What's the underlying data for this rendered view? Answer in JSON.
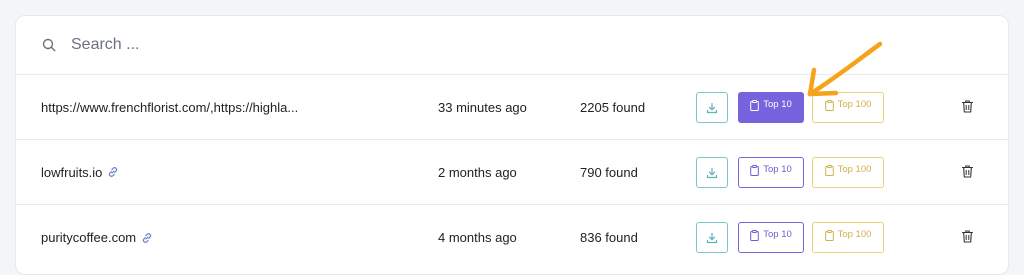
{
  "search": {
    "placeholder": "Search ..."
  },
  "rows": [
    {
      "url": "https://www.frenchflorist.com/,https://highla...",
      "has_link_icon": false,
      "time": "33 minutes ago",
      "count": "2205 found",
      "top10_label": "Top 10",
      "top100_label": "Top 100",
      "top10_active": true
    },
    {
      "url": "lowfruits.io",
      "has_link_icon": true,
      "time": "2 months ago",
      "count": "790 found",
      "top10_label": "Top 10",
      "top100_label": "Top 100",
      "top10_active": false
    },
    {
      "url": "puritycoffee.com",
      "has_link_icon": true,
      "time": "4 months ago",
      "count": "836 found",
      "top10_label": "Top 10",
      "top100_label": "Top 100",
      "top10_active": false
    }
  ],
  "icons": {
    "search": "search-icon",
    "link": "link-icon",
    "download": "download-icon",
    "clipboard": "clipboard-icon",
    "trash": "trash-icon",
    "annotation": "arrow-annotation"
  },
  "colors": {
    "purple": "#7763dd",
    "teal": "#7fc4c6",
    "gold": "#efd07a",
    "arrow": "#f7a21b"
  }
}
